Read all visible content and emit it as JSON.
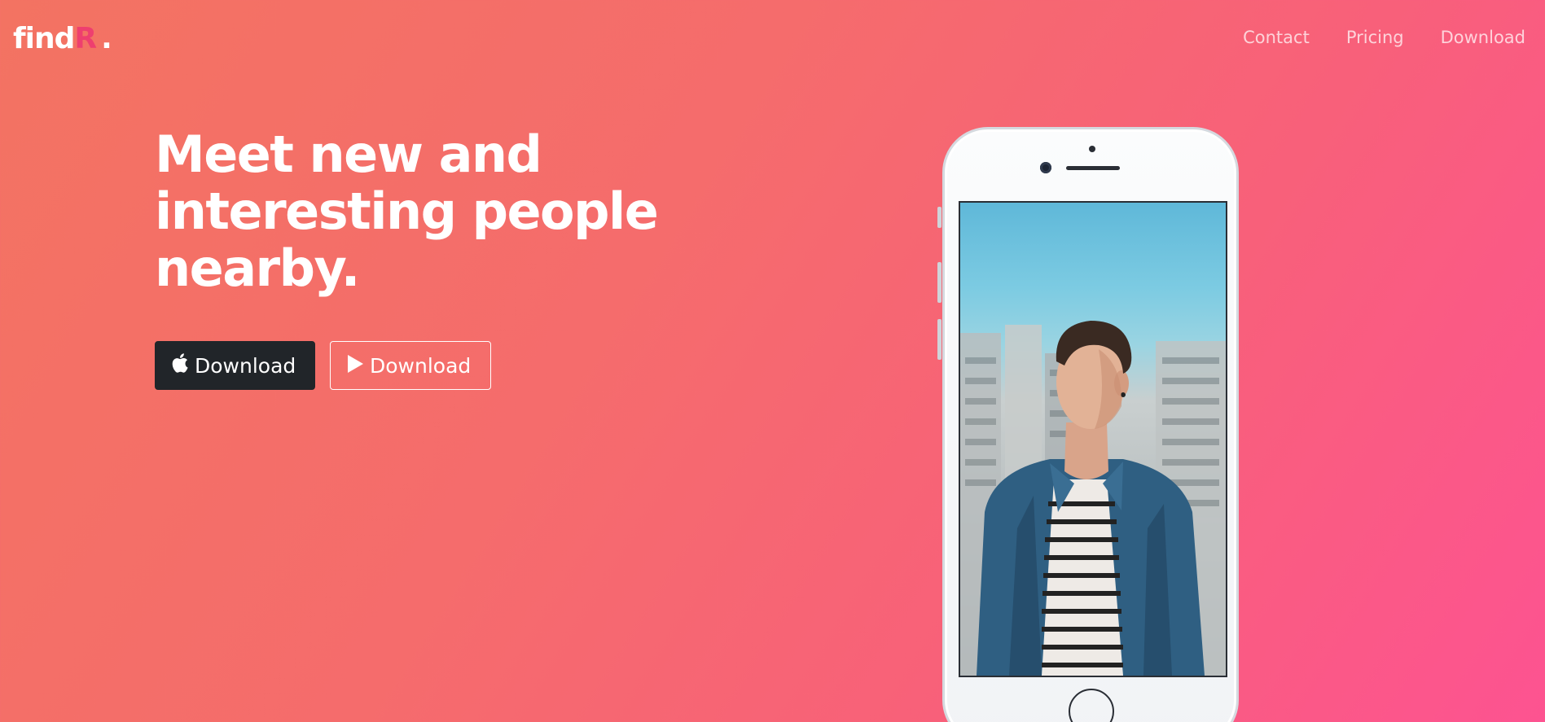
{
  "brand": {
    "prefix": "find",
    "accent": "R",
    "dot": ".",
    "accent_color": "#ee3f6f"
  },
  "nav": {
    "items": [
      {
        "label": "Contact"
      },
      {
        "label": "Pricing"
      },
      {
        "label": "Download"
      }
    ]
  },
  "hero": {
    "title_line1": "Meet new and",
    "title_line2": "interesting people",
    "title_line3": "nearby.",
    "buttons": {
      "apple": {
        "label": "Download",
        "icon": "apple-icon"
      },
      "play": {
        "label": "Download",
        "icon": "play-icon"
      }
    }
  },
  "colors": {
    "gradient_start": "#f37362",
    "gradient_end": "#fd5391",
    "dark_button": "#212529"
  },
  "phone": {
    "screen_image": "man-in-denim-shirt-photo"
  }
}
